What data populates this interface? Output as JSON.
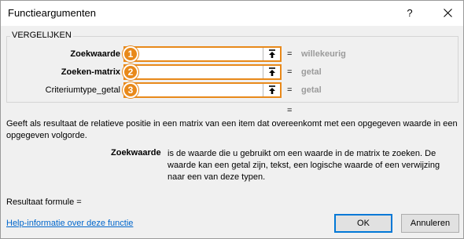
{
  "window": {
    "title": "Functieargumenten",
    "help_glyph": "?",
    "close_glyph": "✕"
  },
  "group": {
    "legend": "VERGELIJKEN",
    "rows": [
      {
        "label": "Zoekwaarde",
        "badge": "1",
        "value": "",
        "equals": "=",
        "hint": "willekeurig"
      },
      {
        "label": "Zoeken-matrix",
        "badge": "2",
        "value": "",
        "equals": "=",
        "hint": "getal"
      },
      {
        "label": "Criteriumtype_getal",
        "badge": "3",
        "value": "",
        "equals": "=",
        "hint": "getal"
      }
    ]
  },
  "result_equals": "=",
  "description": "Geeft als resultaat de relatieve positie in een matrix van een item dat overeenkomt met een opgegeven waarde in een opgegeven volgorde.",
  "arg_help": {
    "name": "Zoekwaarde",
    "text": "is de waarde die u gebruikt om een waarde in de matrix te zoeken. De waarde kan een getal zijn, tekst, een logische waarde of een verwijzing naar een van deze typen."
  },
  "result_label": "Resultaat formule =",
  "help_link": "Help-informatie over deze functie",
  "buttons": {
    "ok": "OK",
    "cancel": "Annuleren"
  },
  "colors": {
    "accent": "#e8891a",
    "link": "#0066cc",
    "hint": "#9b9b9b"
  }
}
